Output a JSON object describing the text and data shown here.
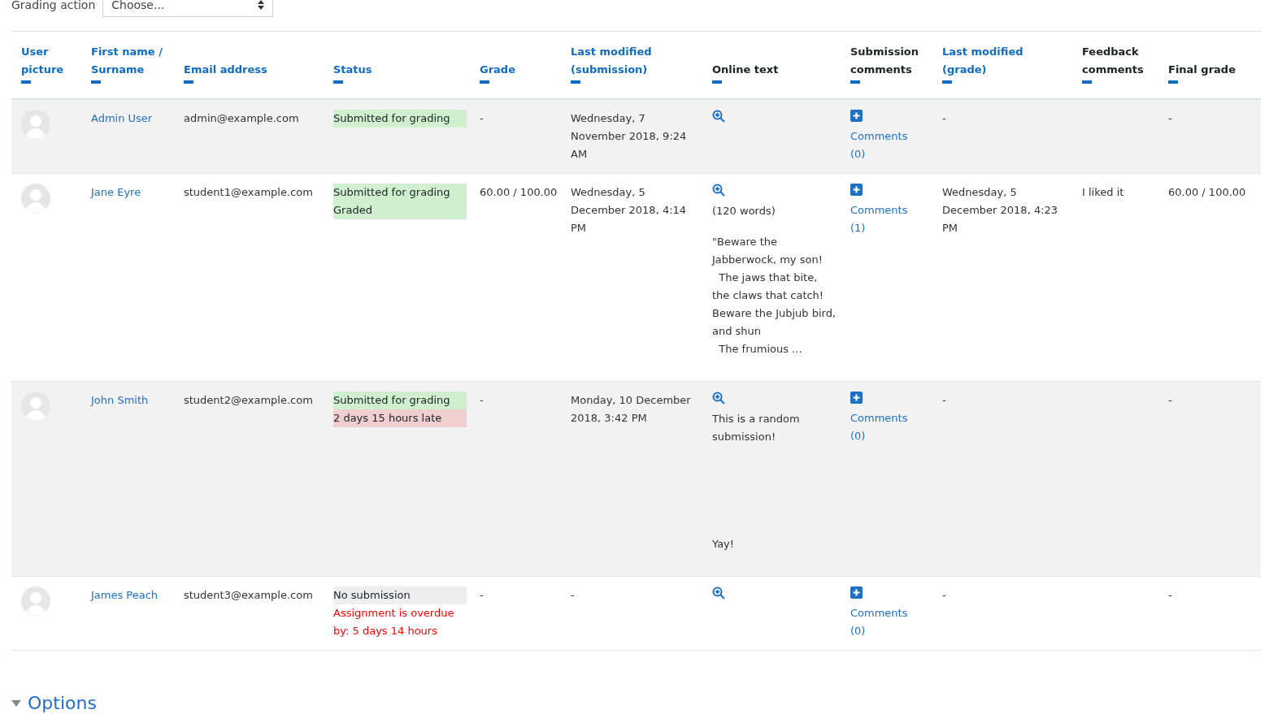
{
  "grading_action": {
    "label": "Grading action",
    "value": "Choose..."
  },
  "table": {
    "columns": [
      {
        "label": "User picture",
        "kind": "link"
      },
      {
        "label": "First name / Surname",
        "kind": "link"
      },
      {
        "label": "Email address",
        "kind": "link"
      },
      {
        "label": "Status",
        "kind": "link"
      },
      {
        "label": "Grade",
        "kind": "link"
      },
      {
        "label": "Last modified (submission)",
        "kind": "link"
      },
      {
        "label": "Online text",
        "kind": "plain"
      },
      {
        "label": "Submission comments",
        "kind": "plain"
      },
      {
        "label": "Last modified (grade)",
        "kind": "link"
      },
      {
        "label": "Feedback comments",
        "kind": "plain"
      },
      {
        "label": "Final grade",
        "kind": "plain"
      }
    ],
    "rows": [
      {
        "name": "Admin User",
        "email": "admin@example.com",
        "status": [
          {
            "text": "Submitted for grading",
            "kind": "submitted"
          }
        ],
        "grade": "-",
        "modified": "Wednesday, 7 November 2018, 9:24 AM",
        "online_text": [],
        "comments_link": "Comments",
        "comments_count": "(0)",
        "modified_grade": "-",
        "feedback": "",
        "final_grade": "-"
      },
      {
        "name": "Jane Eyre",
        "email": "student1@example.com",
        "status": [
          {
            "text": "Submitted for grading",
            "kind": "submitted"
          },
          {
            "text": "Graded",
            "kind": "graded"
          }
        ],
        "grade": "60.00 / 100.00",
        "modified": "Wednesday, 5 December 2018, 4:14 PM",
        "online_text": [
          "(120 words)",
          "\"Beware the Jabberwock, my son!\n  The jaws that bite, the claws that catch!\nBeware the Jubjub bird, and shun\n  The frumious ..."
        ],
        "comments_link": "Comments",
        "comments_count": "(1)",
        "modified_grade": "Wednesday, 5 December 2018, 4:23 PM",
        "feedback": "I liked it",
        "final_grade": "60.00 / 100.00"
      },
      {
        "name": "John Smith",
        "email": "student2@example.com",
        "status": [
          {
            "text": "Submitted for grading",
            "kind": "submitted"
          },
          {
            "text": "2 days 15 hours late",
            "kind": "late"
          }
        ],
        "grade": "-",
        "modified": "Monday, 10 December 2018, 3:42 PM",
        "online_text": [
          "This is a random submission!\n\n\n\n\n\nYay!"
        ],
        "comments_link": "Comments",
        "comments_count": "(0)",
        "modified_grade": "-",
        "feedback": "",
        "final_grade": "-"
      },
      {
        "name": "James Peach",
        "email": "student3@example.com",
        "status": [
          {
            "text": "No submission",
            "kind": "none"
          },
          {
            "text": "Assignment is overdue by: 5 days 14 hours",
            "kind": "overdue"
          }
        ],
        "grade": "-",
        "modified": "-",
        "online_text": [],
        "comments_link": "Comments",
        "comments_count": "(0)",
        "modified_grade": "-",
        "feedback": "",
        "final_grade": "-"
      }
    ]
  },
  "options": {
    "label": "Options",
    "expanded": true
  }
}
